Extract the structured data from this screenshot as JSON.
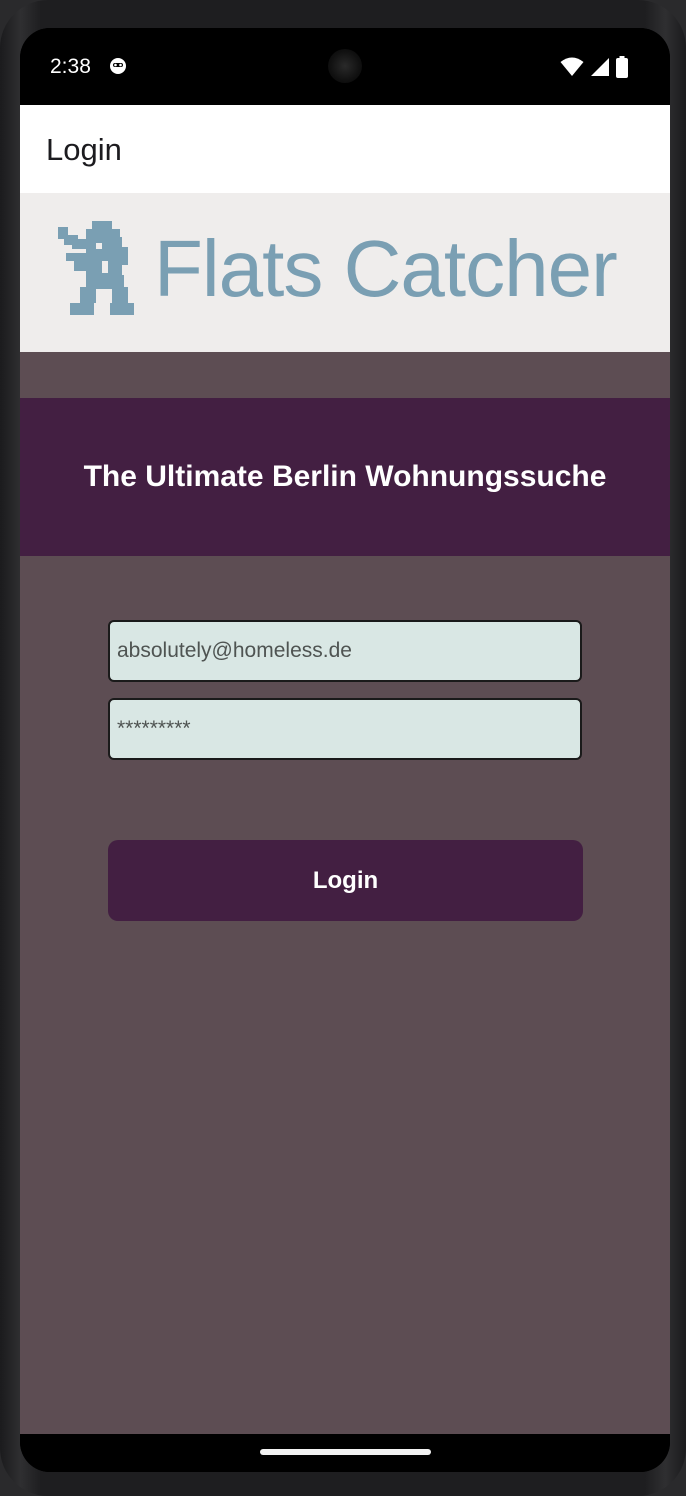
{
  "status_bar": {
    "time": "2:38",
    "icons": [
      "face-icon",
      "wifi-icon",
      "cellular-signal-icon",
      "battery-icon"
    ]
  },
  "app_bar": {
    "title": "Login"
  },
  "logo": {
    "icon": "berlin-bear-icon",
    "text": "Flats Catcher",
    "color": "#7a9fb3"
  },
  "tagline": "The Ultimate Berlin Wohnungssuche",
  "form": {
    "email_value": "absolutely@homeless.de",
    "password_value": "*********"
  },
  "login_button_label": "Login",
  "colors": {
    "primary": "#431f42",
    "background": "#5d4d53",
    "field_background": "#d9e7e4",
    "banner_background": "#efedec"
  }
}
